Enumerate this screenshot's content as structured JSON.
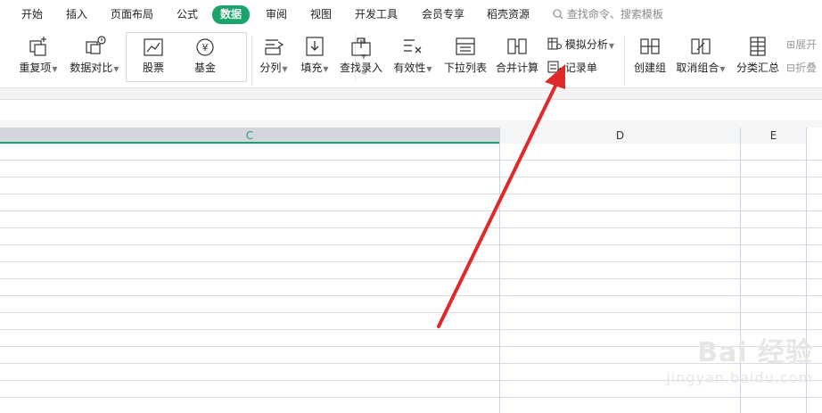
{
  "menu": {
    "tabs": [
      {
        "label": "开始"
      },
      {
        "label": "插入"
      },
      {
        "label": "页面布局"
      },
      {
        "label": "公式"
      },
      {
        "label": "数据",
        "active": true
      },
      {
        "label": "审阅"
      },
      {
        "label": "视图"
      },
      {
        "label": "开发工具"
      },
      {
        "label": "会员专享"
      },
      {
        "label": "稻壳资源"
      }
    ],
    "search_placeholder": "查找命令、搜索模板"
  },
  "ribbon": {
    "repeat": "重复项",
    "compare": "数据对比",
    "stocks": "股票",
    "fund": "基金",
    "split": "分列",
    "fill": "填充",
    "lookup": "查找录入",
    "validity": "有效性",
    "dropdown": "下拉列表",
    "merge_calc": "合并计算",
    "what_if": "模拟分析",
    "record": "记录单",
    "group": "创建组",
    "ungroup": "取消组合",
    "subtotal": "分类汇总",
    "expand": "展开",
    "collapse": "折叠"
  },
  "sheet": {
    "columns": [
      "C",
      "D",
      "E"
    ],
    "selected_column": "C"
  },
  "watermark": {
    "brand": "Bai 经验",
    "url": "jingyan.baidu.com"
  },
  "colors": {
    "accent": "#1aa36a",
    "arrow": "#e02a2a"
  }
}
